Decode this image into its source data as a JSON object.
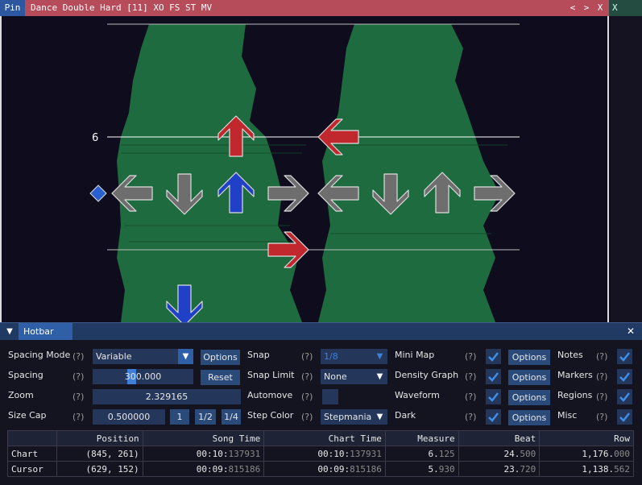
{
  "window": {
    "pin_label": "Pin",
    "title": "Dance Double Hard [11] XO FS ST MV",
    "nav_prev": "<",
    "nav_next": ">",
    "close": "X",
    "side_tab": "X"
  },
  "chart": {
    "measure_label": "6",
    "colors": {
      "quarter": "#c0282e",
      "eighth": "#2040c8",
      "receptor": "#6e6e6e",
      "waveform": "#1e6b3f",
      "marker": "#2a5fd0"
    }
  },
  "hotbar": {
    "title": "Hotbar",
    "close": "✕",
    "help": "(?)",
    "spacing_mode": {
      "label": "Spacing Mode",
      "value": "Variable",
      "button": "Options"
    },
    "spacing": {
      "label": "Spacing",
      "value": "300.000",
      "slider_fraction": 0.08,
      "button": "Reset"
    },
    "zoom": {
      "label": "Zoom",
      "value": "2.329165"
    },
    "size_cap": {
      "label": "Size Cap",
      "value": "0.500000",
      "buttons": [
        "1",
        "1/2",
        "1/4"
      ]
    },
    "snap": {
      "label": "Snap",
      "value": "1/8"
    },
    "snap_limit": {
      "label": "Snap Limit",
      "value": "None"
    },
    "automove": {
      "label": "Automove"
    },
    "step_color": {
      "label": "Step Color",
      "value": "Stepmania"
    },
    "mini_map": {
      "label": "Mini Map",
      "checked": true,
      "button": "Options"
    },
    "density_graph": {
      "label": "Density Graph",
      "checked": true,
      "button": "Options"
    },
    "waveform": {
      "label": "Waveform",
      "checked": true,
      "button": "Options"
    },
    "dark": {
      "label": "Dark",
      "checked": true,
      "button": "Options"
    },
    "notes": {
      "label": "Notes",
      "checked": true
    },
    "markers": {
      "label": "Markers",
      "checked": true
    },
    "regions": {
      "label": "Regions",
      "checked": true
    },
    "misc": {
      "label": "Misc",
      "checked": true
    }
  },
  "table": {
    "headers": [
      "",
      "Position",
      "Song Time",
      "Chart Time",
      "Measure",
      "Beat",
      "Row"
    ],
    "rows": [
      {
        "name": "Chart",
        "position": "(845, 261)",
        "song_time_main": "00:10:",
        "song_time_frac": "137931",
        "chart_time_main": "00:10:",
        "chart_time_frac": "137931",
        "measure_main": "6.",
        "measure_frac": "125",
        "beat_main": "24.",
        "beat_frac": "500",
        "row_main": "1,176.",
        "row_frac": "000"
      },
      {
        "name": "Cursor",
        "position": "(629, 152)",
        "song_time_main": "00:09:",
        "song_time_frac": "815186",
        "chart_time_main": "00:09:",
        "chart_time_frac": "815186",
        "measure_main": "5.",
        "measure_frac": "930",
        "beat_main": "23.",
        "beat_frac": "720",
        "row_main": "1,138.",
        "row_frac": "562"
      }
    ]
  }
}
